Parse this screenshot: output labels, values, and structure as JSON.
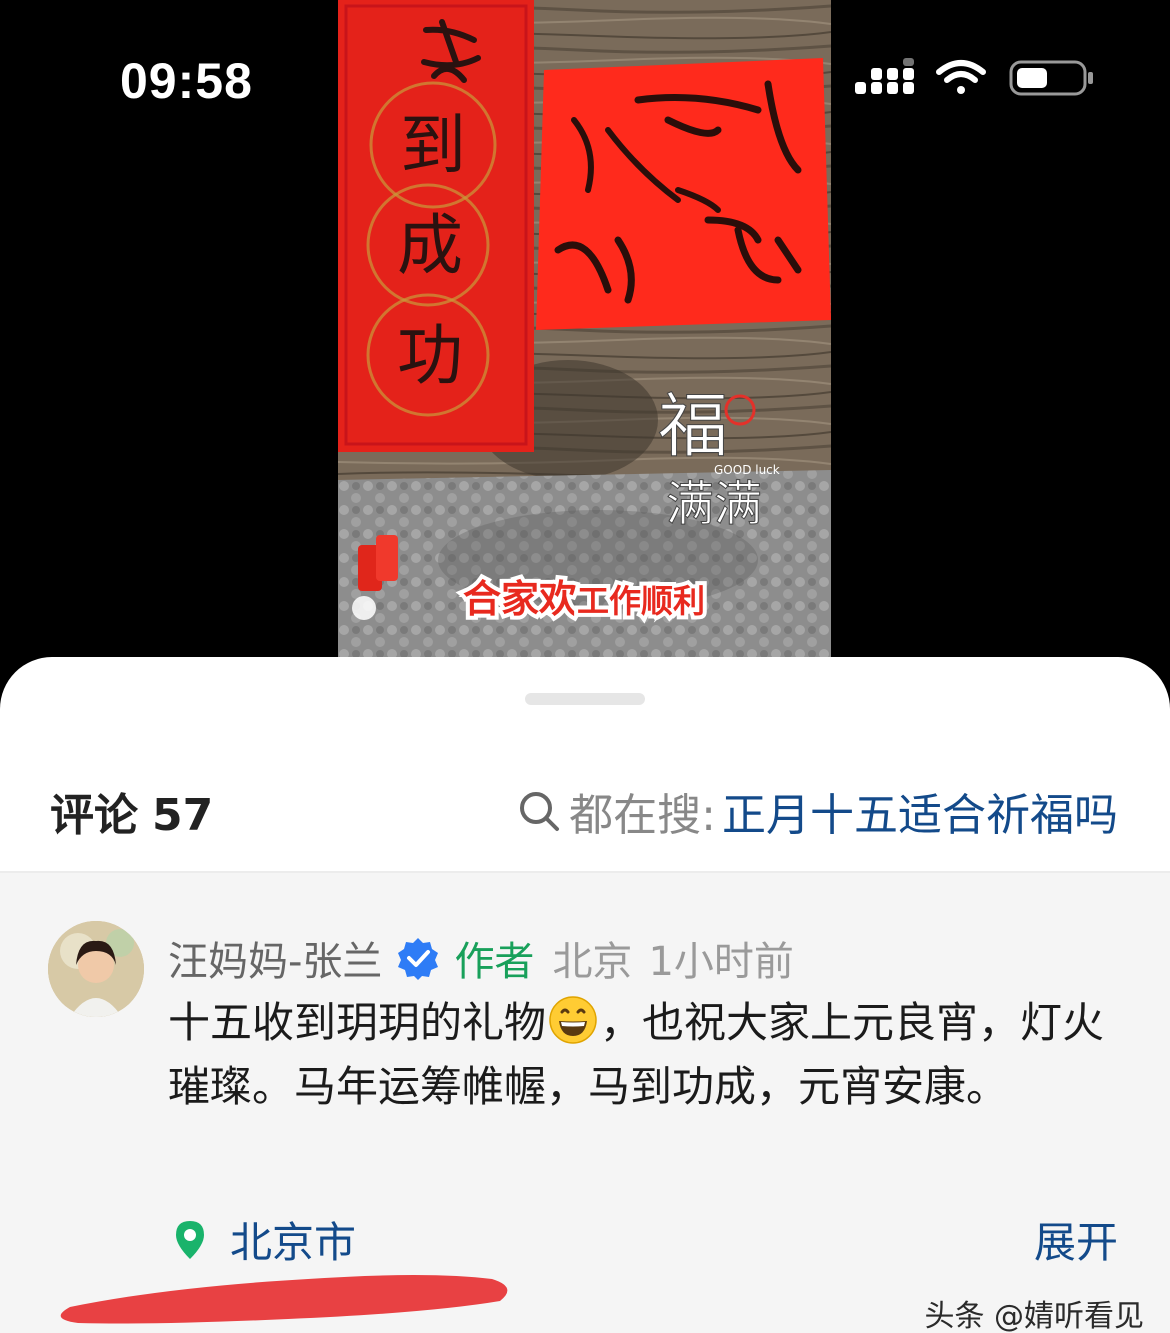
{
  "status_bar": {
    "time": "09:58",
    "icons": [
      "signal-icon",
      "wifi-icon",
      "battery-icon"
    ]
  },
  "video": {
    "couplet_chars": [
      "到",
      "成",
      "功"
    ],
    "fu_sticker_line1": "福",
    "fu_sticker_line2": "满满",
    "fu_sticker_small": "GOOD luck",
    "caption_part1": "合家欢",
    "caption_part2": "工作顺利"
  },
  "comments_panel": {
    "title": "评论",
    "count": "57",
    "trending_label": "都在搜:",
    "trending_query": "正月十五适合祈福吗"
  },
  "comment": {
    "username": "汪妈妈-张兰",
    "author_tag": "作者",
    "location_meta": "北京",
    "time_ago": "1小时前",
    "text_before_emoji": "十五收到玥玥的礼物",
    "text_after_emoji": "，也祝大家上元良宵，灯火璀璨。马年运筹帷幄，马到功成，元宵安康。",
    "location": "北京市",
    "expand_label": "展开"
  },
  "watermark": "头条 @婧听看见",
  "colors": {
    "link_blue": "#134a8a",
    "author_green": "#18a05a",
    "verified_blue": "#2e7cf6",
    "scribble_red": "#e84143",
    "comments_bg": "#f5f5f5"
  }
}
